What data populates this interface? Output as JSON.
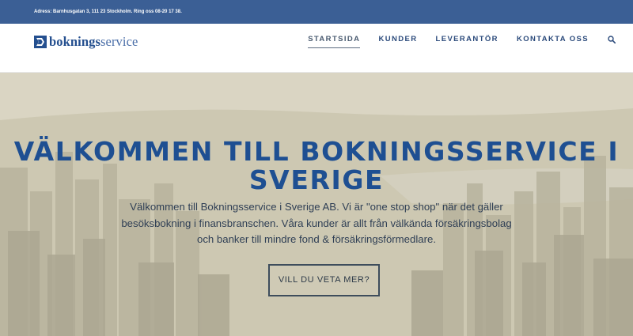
{
  "topbar": {
    "address": "Adress: Barnhusgatan 3, 111 23 Stockholm. Ring oss 08-20 17 38."
  },
  "header": {
    "logo": {
      "bold": "boknings",
      "light": "service"
    },
    "nav": [
      {
        "label": "STARTSIDA",
        "active": true
      },
      {
        "label": "KUNDER"
      },
      {
        "label": "LEVERANTÖR"
      },
      {
        "label": "KONTAKTA OSS"
      }
    ],
    "search_icon": "search-icon"
  },
  "hero": {
    "title": "VÄLKOMMEN TILL BOKNINGSSERVICE I SVERIGE",
    "text": "Välkommen till Bokningsservice i Sverige AB. Vi är \"one stop shop\" när det gäller besöksbokning i finansbranschen. Våra kunder är allt från välkända försäkringsbolag och banker till mindre fond & försäkringsförmedlare.",
    "button_label": "VILL DU VETA MER?"
  },
  "colors": {
    "topbar": "#3b5f95",
    "brand": "#244f8f",
    "title": "#1e4f92"
  }
}
